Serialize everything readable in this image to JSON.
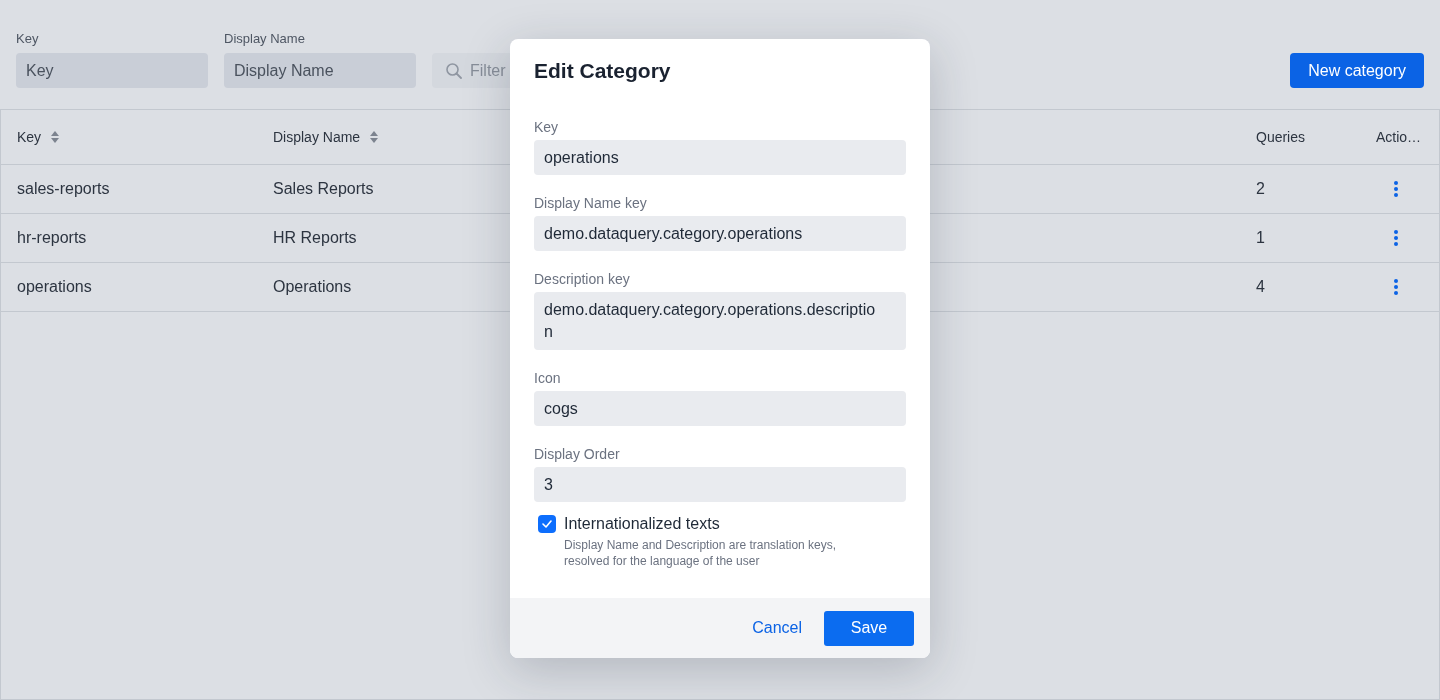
{
  "filters": [
    {
      "label": "Key",
      "placeholder": "Key"
    },
    {
      "label": "Display Name",
      "placeholder": "Display Name"
    }
  ],
  "search": {
    "placeholder": "Filter"
  },
  "new_button": {
    "label": "New category"
  },
  "table": {
    "columns": [
      {
        "label": "Key",
        "sortable": true
      },
      {
        "label": "Display Name",
        "sortable": true
      },
      {
        "label": "Queries",
        "sortable": false
      },
      {
        "label": "Actio…",
        "sortable": false
      }
    ],
    "rows": [
      {
        "key": "sales-reports",
        "display_name": "Sales Reports",
        "queries": "2"
      },
      {
        "key": "hr-reports",
        "display_name": "HR Reports",
        "queries": "1"
      },
      {
        "key": "operations",
        "display_name": "Operations",
        "queries": "4"
      }
    ]
  },
  "dialog": {
    "title": "Edit Category",
    "fields": [
      {
        "kind": "text",
        "label": "Key",
        "value": "operations"
      },
      {
        "kind": "text",
        "label": "Display Name key",
        "value": "demo.dataquery.category.operations"
      },
      {
        "kind": "multiline",
        "label": "Description key",
        "value": "demo.dataquery.category.operations.description"
      },
      {
        "kind": "text",
        "label": "Icon",
        "value": "cogs"
      },
      {
        "kind": "text",
        "label": "Display Order",
        "value": "3"
      }
    ],
    "checkbox": {
      "label": "Internationalized texts",
      "checked": true,
      "help": "Display Name and Description are translation keys, resolved for the language of the user"
    },
    "buttons": [
      {
        "kind": "link",
        "label": "Cancel"
      },
      {
        "kind": "primary",
        "label": "Save"
      }
    ]
  }
}
